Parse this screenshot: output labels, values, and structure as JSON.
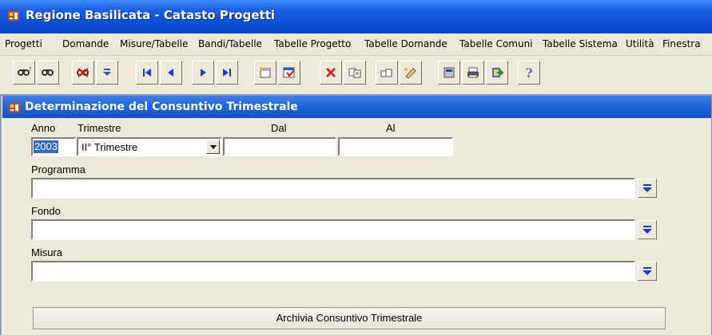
{
  "window": {
    "title": "Regione Basilicata - Catasto Progetti"
  },
  "menu": [
    "Progetti",
    "Domande",
    "Misure/Tabelle",
    "Bandi/Tabelle",
    "Tabelle Progetto",
    "Tabelle Domande",
    "Tabelle Comuni",
    "Tabelle Sistema",
    "Utilità",
    "Finestra"
  ],
  "toolbar": {
    "icons": [
      "find-icon",
      "find-next-icon",
      "clear-find-icon",
      "list-icon",
      "first-record-icon",
      "previous-record-icon",
      "next-record-icon",
      "last-record-icon",
      "new-record-icon",
      "save-icon",
      "delete-icon",
      "copy-icon",
      "duplicate-icon",
      "edit-icon",
      "calculator-icon",
      "print-icon",
      "exit-icon",
      "help-icon"
    ],
    "help_glyph": "?"
  },
  "form": {
    "title": "Determinazione del Consuntivo Trimestrale",
    "labels": {
      "anno": "Anno",
      "trimestre": "Trimestre",
      "dal": "Dal",
      "al": "Al",
      "programma": "Programma",
      "fondo": "Fondo",
      "misura": "Misura"
    },
    "values": {
      "anno": "2003",
      "trimestre": "II° Trimestre",
      "dal": "",
      "al": "",
      "programma": "",
      "fondo": "",
      "misura": ""
    },
    "button_label": "Archivia Consuntivo Trimestrale"
  },
  "colors": {
    "title_blue": "#0b4fd8",
    "face": "#ece9d8",
    "mdi_bg": "#8a98b8",
    "selection": "#316ac5"
  }
}
